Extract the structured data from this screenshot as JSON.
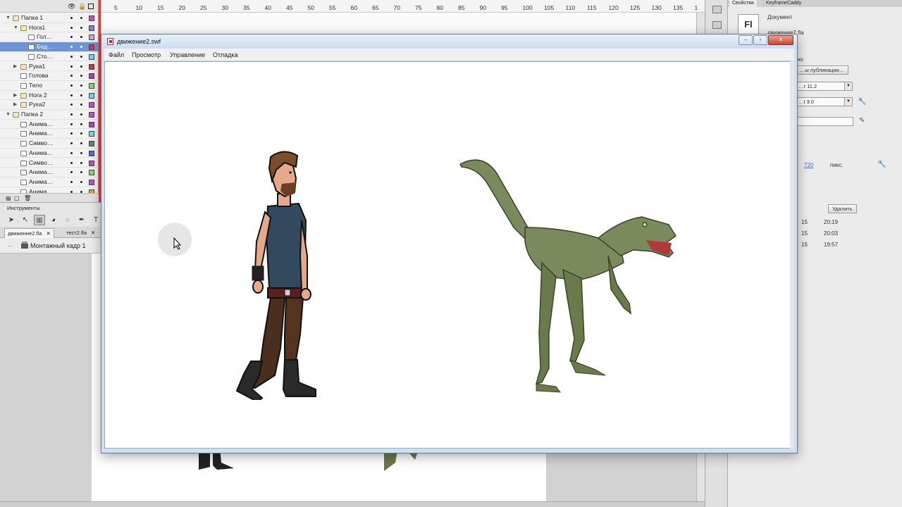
{
  "layers_panel": {
    "rows": [
      {
        "name": "Папка 1",
        "kind": "folder",
        "level": 0,
        "expanded": true,
        "color": "#c04fd0",
        "selected": false
      },
      {
        "name": "Нога1",
        "kind": "folder",
        "level": 1,
        "expanded": true,
        "color": "#7f7fcc",
        "selected": false
      },
      {
        "name": "Гол…",
        "kind": "layer",
        "level": 2,
        "expanded": false,
        "color": "#c7a9e0",
        "selected": false
      },
      {
        "name": "Бед…",
        "kind": "layer",
        "level": 2,
        "expanded": false,
        "color": "#d9344a",
        "selected": true
      },
      {
        "name": "Сто…",
        "kind": "layer",
        "level": 2,
        "expanded": false,
        "color": "#62e0f0",
        "selected": false
      },
      {
        "name": "Рука1",
        "kind": "folder",
        "level": 1,
        "expanded": false,
        "color": "#d9344a",
        "selected": false
      },
      {
        "name": "Голова",
        "kind": "layer",
        "level": 1,
        "expanded": false,
        "color": "#b03fc0",
        "selected": false
      },
      {
        "name": "Тело",
        "kind": "layer",
        "level": 1,
        "expanded": false,
        "color": "#7be06a",
        "selected": false
      },
      {
        "name": "Нога 2",
        "kind": "folder",
        "level": 1,
        "expanded": false,
        "color": "#62e0f0",
        "selected": false
      },
      {
        "name": "Рука2",
        "kind": "folder",
        "level": 1,
        "expanded": false,
        "color": "#c04fd0",
        "selected": false
      },
      {
        "name": "Папка 2",
        "kind": "folder",
        "level": 0,
        "expanded": true,
        "color": "#c04fd0",
        "selected": false
      },
      {
        "name": "Анима…",
        "kind": "layer",
        "level": 1,
        "expanded": false,
        "color": "#b03fc0",
        "selected": false
      },
      {
        "name": "Анима…",
        "kind": "layer",
        "level": 1,
        "expanded": false,
        "color": "#62e0f0",
        "selected": false
      },
      {
        "name": "Симво…",
        "kind": "layer",
        "level": 1,
        "expanded": false,
        "color": "#777777",
        "selected": false
      },
      {
        "name": "Анима…",
        "kind": "layer",
        "level": 1,
        "expanded": false,
        "color": "#4f6fd0",
        "selected": false
      },
      {
        "name": "Симво…",
        "kind": "layer",
        "level": 1,
        "expanded": false,
        "color": "#c04fd0",
        "selected": false
      },
      {
        "name": "Анима…",
        "kind": "layer",
        "level": 1,
        "expanded": false,
        "color": "#7be06a",
        "selected": false
      },
      {
        "name": "Анима…",
        "kind": "layer",
        "level": 1,
        "expanded": false,
        "color": "#c04fd0",
        "selected": false
      },
      {
        "name": "Анима…",
        "kind": "layer",
        "level": 1,
        "expanded": false,
        "color": "#e0a040",
        "selected": false
      }
    ]
  },
  "timeline": {
    "ruler_labels": [
      "5",
      "10",
      "15",
      "20",
      "25",
      "30",
      "35",
      "40",
      "45",
      "50",
      "55",
      "60",
      "65",
      "70",
      "75",
      "80",
      "85",
      "90",
      "95",
      "100",
      "105",
      "110",
      "115",
      "120",
      "125",
      "130",
      "135",
      "1"
    ]
  },
  "tools_panel": {
    "title": "Инструменты",
    "tools": [
      "selection-arrow",
      "subselection-arrow",
      "free-transform",
      "3d-rotation",
      "lasso",
      "pen",
      "text"
    ]
  },
  "doc_tabs": [
    {
      "label": "движение2.fla",
      "active": true
    },
    {
      "label": "тест2.fla",
      "active": false
    }
  ],
  "scene": {
    "label": "Монтажный кадр 1"
  },
  "swf_window": {
    "title": "движение2.swf",
    "menu": [
      "Файл",
      "Просмотр",
      "Управление",
      "Отладка"
    ],
    "buttons": {
      "minimize": "–",
      "maximize": "▫",
      "close": "✕"
    }
  },
  "properties_panel": {
    "tabs": [
      "Свойства",
      "KeyframeCaddy"
    ],
    "logo": "Fl",
    "doc_label": "Документ",
    "doc_name": "движение2.fla",
    "publish_partial": "но",
    "publish_button": "…ы публикации…",
    "player_version": "…r 11.2",
    "script_version": "…t 3.0",
    "height_value": "720",
    "units": "пикс.",
    "delete_button": "Удалить",
    "history": [
      {
        "date": "15",
        "time": "20:19"
      },
      {
        "date": "15",
        "time": "20:03"
      },
      {
        "date": "15",
        "time": "19:57"
      }
    ]
  },
  "colors": {
    "selected_layer": "#6d95d6",
    "playhead": "#e23a3a",
    "window_title": "#c9dcef"
  }
}
